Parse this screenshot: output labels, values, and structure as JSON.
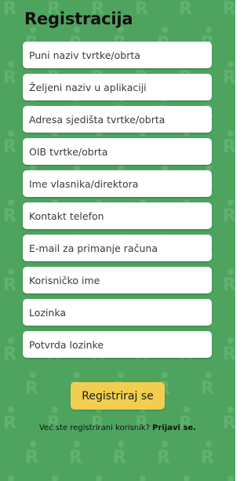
{
  "colors": {
    "background": "#4ea45f",
    "pattern": "#62b070",
    "field": "#ffffff",
    "button": "#f1ce4f"
  },
  "pattern_glyph": "R",
  "header": {
    "title": "Registracija"
  },
  "form": {
    "fields": [
      {
        "placeholder": "Puni naziv tvrtke/obrta"
      },
      {
        "placeholder": "Željeni naziv u aplikaciji"
      },
      {
        "placeholder": "Adresa sjedišta tvrtke/obrta"
      },
      {
        "placeholder": "OIB tvrtke/obrta"
      },
      {
        "placeholder": "Ime vlasnika/direktora"
      },
      {
        "placeholder": "Kontakt telefon"
      },
      {
        "placeholder": "E-mail za primanje računa"
      },
      {
        "placeholder": "Korisničko ime"
      },
      {
        "placeholder": "Lozinka"
      },
      {
        "placeholder": "Potvrda lozinke"
      }
    ],
    "submit_label": "Registriraj se"
  },
  "footer": {
    "question": "Već ste registrirani korisnik?",
    "login_link": "Prijavi se."
  }
}
